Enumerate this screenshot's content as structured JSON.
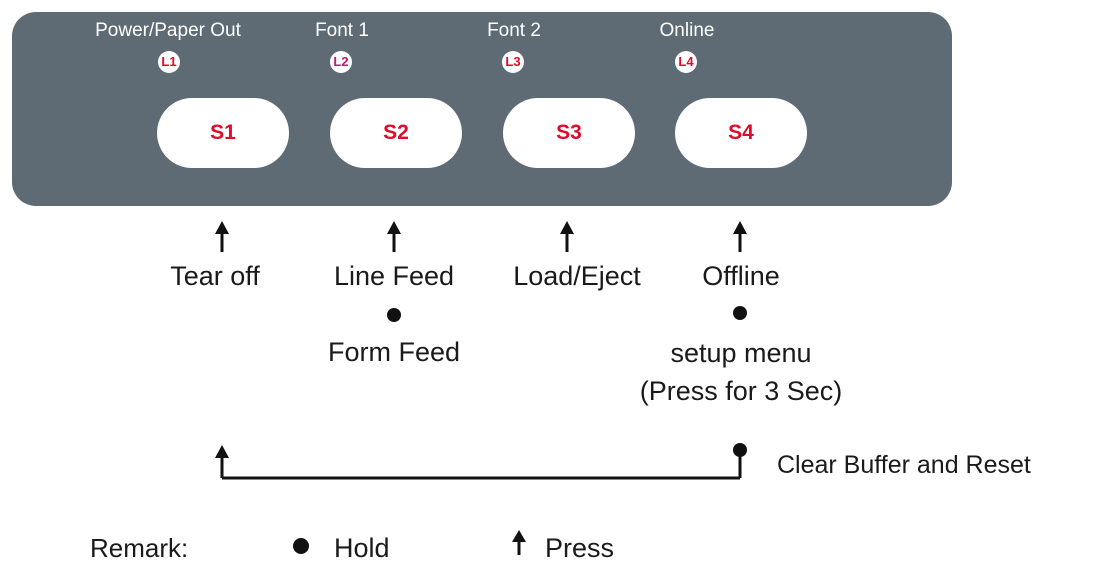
{
  "leds": [
    {
      "indicator": "L1",
      "label": "Power/Paper Out"
    },
    {
      "indicator": "L2",
      "label": "Font 1"
    },
    {
      "indicator": "L3",
      "label": "Font 2"
    },
    {
      "indicator": "L4",
      "label": "Online"
    }
  ],
  "keys": [
    "S1",
    "S2",
    "S3",
    "S4"
  ],
  "functions": {
    "s1_press": "Tear off",
    "s2_press": "Line Feed",
    "s2_hold": "Form Feed",
    "s3_press": "Load/Eject",
    "s4_press": "Offline",
    "s4_hold": "setup menu",
    "s4_hold_note": "(Press for 3 Sec)",
    "combo": "Clear Buffer and Reset"
  },
  "remark": {
    "label": "Remark:",
    "hold": "Hold",
    "press": "Press"
  },
  "colors": {
    "panel": "#5e6a74",
    "key_text": "#e00a2a",
    "led_l2_text": "#c2186e"
  }
}
